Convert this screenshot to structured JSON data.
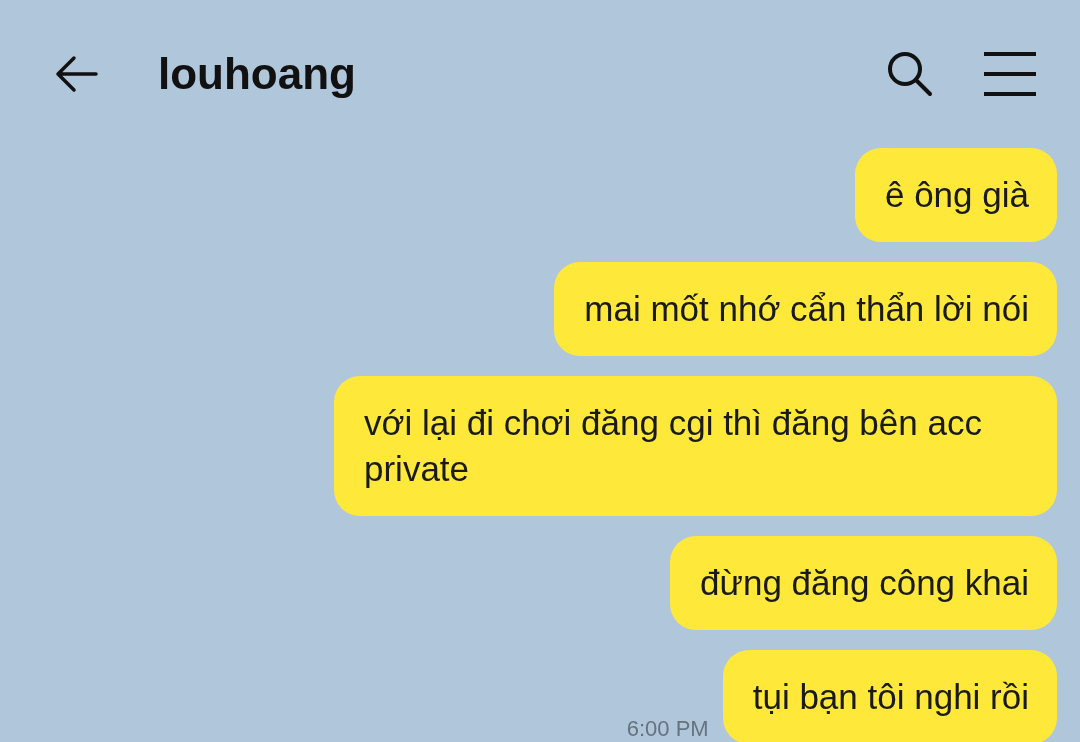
{
  "header": {
    "title": "louhoang"
  },
  "messages": [
    {
      "text": "ê ông già"
    },
    {
      "text": "mai mốt nhớ cẩn thẩn lời nói"
    },
    {
      "text": "với lại đi chơi đăng cgi thì đăng bên acc private"
    },
    {
      "text": "đừng đăng công khai"
    },
    {
      "text": "tụi bạn tôi nghi rồi",
      "time": "6:00 PM"
    }
  ]
}
